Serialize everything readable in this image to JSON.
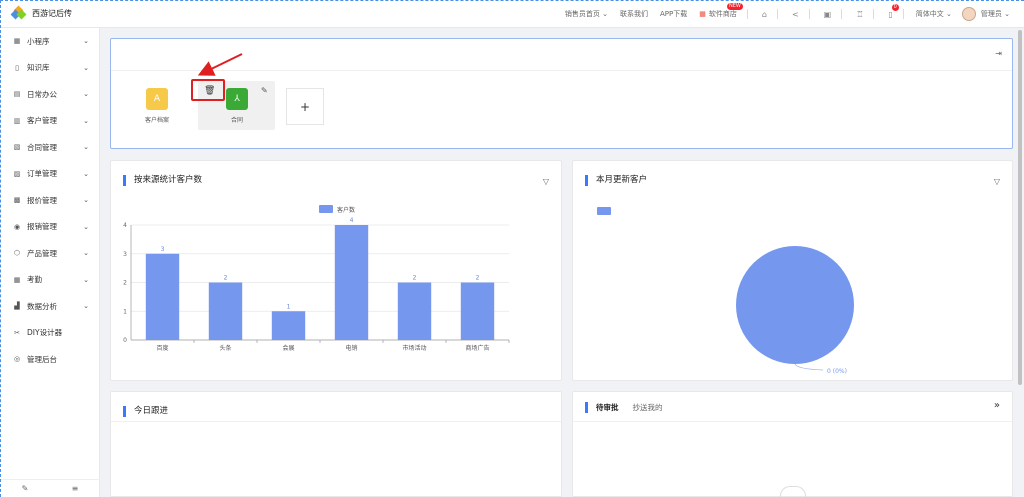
{
  "app": {
    "title": "西游记后传"
  },
  "topnav": {
    "links": [
      "销售员首页",
      "联系我们",
      "APP下载",
      "软件商店"
    ],
    "store_badge": "NEW",
    "notify_count": "0",
    "language": "简体中文",
    "user": "管理员"
  },
  "sidebar": {
    "items": [
      {
        "label": "小程序",
        "icon": "grid-icon",
        "has_chevron": true
      },
      {
        "label": "知识库",
        "icon": "book-icon",
        "has_chevron": true
      },
      {
        "label": "日常办公",
        "icon": "briefcase-icon",
        "has_chevron": true
      },
      {
        "label": "客户管理",
        "icon": "contacts-icon",
        "has_chevron": true
      },
      {
        "label": "合同管理",
        "icon": "contract-icon",
        "has_chevron": true
      },
      {
        "label": "订单管理",
        "icon": "order-icon",
        "has_chevron": true
      },
      {
        "label": "报价管理",
        "icon": "quote-icon",
        "has_chevron": true
      },
      {
        "label": "报销管理",
        "icon": "reimburse-icon",
        "has_chevron": true
      },
      {
        "label": "产品管理",
        "icon": "cube-icon",
        "has_chevron": true
      },
      {
        "label": "考勤",
        "icon": "grid-icon",
        "has_chevron": true
      },
      {
        "label": "数据分析",
        "icon": "chart-icon",
        "has_chevron": true
      },
      {
        "label": "DIY设计器",
        "icon": "tools-icon",
        "has_chevron": false
      },
      {
        "label": "管理后台",
        "icon": "settings-icon",
        "has_chevron": false
      }
    ]
  },
  "quick_apps": {
    "items": [
      {
        "label": "客户档案",
        "icon_text": "A",
        "color": "#f7c948"
      },
      {
        "label": "合同",
        "icon_text": "⅄",
        "color": "#3aa935"
      }
    ],
    "add_label": "+"
  },
  "panels": {
    "source_chart_title": "按来源统计客户数",
    "monthly_title": "本月更新客户",
    "today_title": "今日跟进",
    "approve_tabs": [
      "待审批",
      "抄送我的"
    ]
  },
  "chart_data": [
    {
      "type": "bar",
      "title": "按来源统计客户数",
      "categories": [
        "百度",
        "头条",
        "会展",
        "电销",
        "市场活动",
        "商场广告"
      ],
      "series": [
        {
          "name": "客户数",
          "values": [
            3,
            2,
            1,
            4,
            2,
            2
          ]
        }
      ],
      "ylim": [
        0,
        4
      ],
      "yticks": [
        0,
        1,
        2,
        3,
        4
      ],
      "grid": true,
      "legend": "top-center",
      "color": "#7597ee"
    },
    {
      "type": "pie",
      "title": "本月更新客户",
      "slices": [
        {
          "label": "",
          "value": 0,
          "display": "0 (0%)"
        }
      ],
      "legend": "top-left",
      "color": "#7597ee"
    }
  ],
  "colors": {
    "accent": "#3a7afe",
    "bar": "#7597ee",
    "highlight": "#e02020"
  }
}
